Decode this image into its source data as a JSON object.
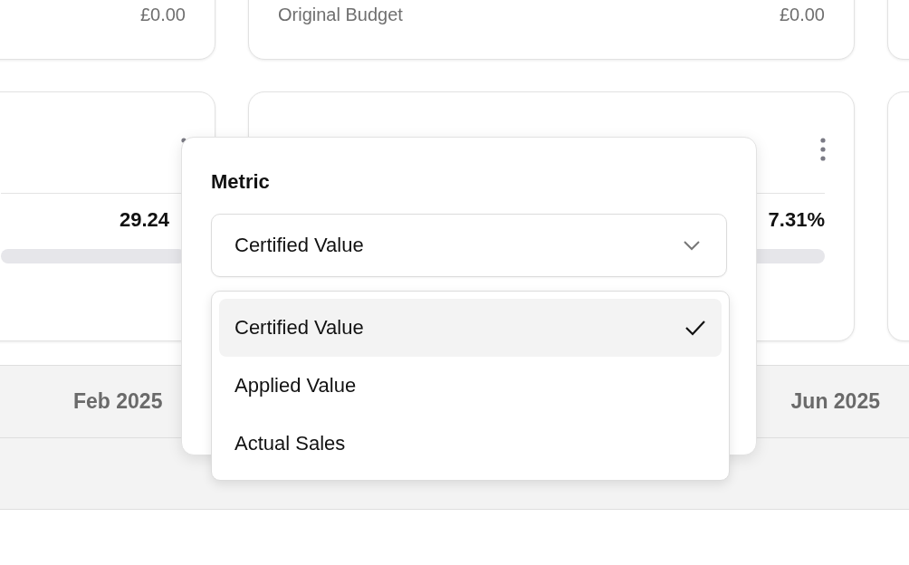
{
  "top_cards": [
    {
      "value": "£0.00"
    },
    {
      "label": "Original Budget",
      "value": "£0.00"
    }
  ],
  "metric_cards": [
    {
      "percent": "29.24",
      "level": 0
    },
    {
      "percent": "7.31%",
      "level": 0
    }
  ],
  "timeline": {
    "months": [
      "Feb 2025",
      "Jun 2025"
    ]
  },
  "popover": {
    "label": "Metric",
    "select": {
      "value": "Certified Value"
    },
    "options": [
      {
        "label": "Certified Value",
        "selected": true
      },
      {
        "label": "Applied Value",
        "selected": false
      },
      {
        "label": "Actual Sales",
        "selected": false
      }
    ]
  }
}
